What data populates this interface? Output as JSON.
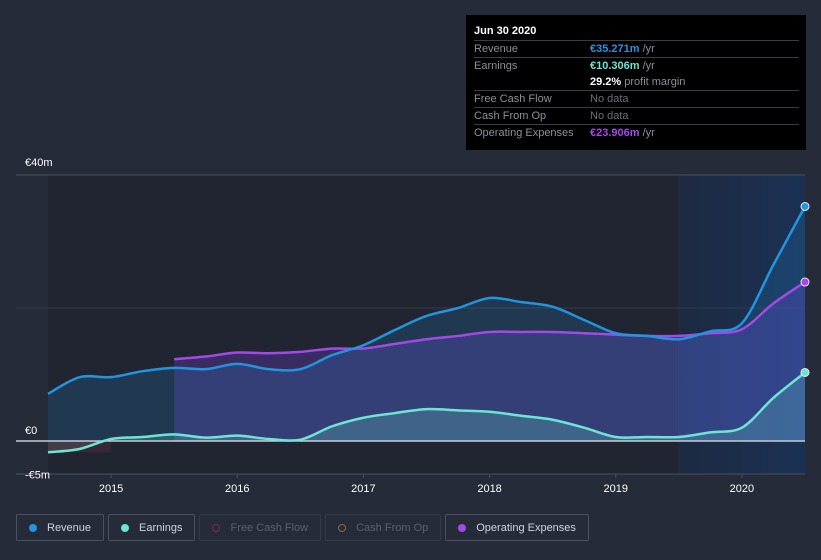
{
  "tooltip": {
    "date": "Jun 30 2020",
    "rows": [
      {
        "label": "Revenue",
        "value": "€35.271m",
        "unit": " /yr",
        "color": "#2394df"
      },
      {
        "label": "Earnings",
        "value": "€10.306m",
        "unit": " /yr",
        "color": "#6ce5d3"
      },
      {
        "label": "",
        "value": "29.2%",
        "unit": " profit margin",
        "color": "#ffffff"
      },
      {
        "label": "Free Cash Flow",
        "value": "No data",
        "unit": "",
        "color": "#6b707a"
      },
      {
        "label": "Cash From Op",
        "value": "No data",
        "unit": "",
        "color": "#6b707a"
      },
      {
        "label": "Operating Expenses",
        "value": "€23.906m",
        "unit": " /yr",
        "color": "#a349e8"
      }
    ]
  },
  "legend": [
    {
      "label": "Revenue",
      "color": "#2394df",
      "active": true
    },
    {
      "label": "Earnings",
      "color": "#6ce5d3",
      "active": true
    },
    {
      "label": "Free Cash Flow",
      "color": "#7a2f4f",
      "active": false
    },
    {
      "label": "Cash From Op",
      "color": "#8a6a3a",
      "active": false
    },
    {
      "label": "Operating Expenses",
      "color": "#a349e8",
      "active": true
    }
  ],
  "chart_data": {
    "type": "area",
    "title": "",
    "xlabel": "",
    "ylabel": "",
    "ylim": [
      -5,
      40
    ],
    "xlim": [
      2014.5,
      2020.5
    ],
    "y_tick_labels": [
      {
        "value": 40,
        "label": "€40m"
      },
      {
        "value": 0,
        "label": "€0"
      },
      {
        "value": -5,
        "label": "-€5m"
      }
    ],
    "x_tick_labels": [
      2015,
      2016,
      2017,
      2018,
      2019,
      2020
    ],
    "highlight_from": 2019.5,
    "grid": true,
    "legend_position": "bottom-left",
    "series": [
      {
        "name": "Revenue",
        "color": "#2394df",
        "x": [
          2014.5,
          2014.75,
          2015,
          2015.25,
          2015.5,
          2015.75,
          2016,
          2016.25,
          2016.5,
          2016.75,
          2017,
          2017.25,
          2017.5,
          2017.75,
          2018,
          2018.25,
          2018.5,
          2018.75,
          2019,
          2019.25,
          2019.5,
          2019.75,
          2020,
          2020.25,
          2020.5
        ],
        "values": [
          7.1,
          9.6,
          9.6,
          10.5,
          11.0,
          10.8,
          11.6,
          10.8,
          10.8,
          12.9,
          14.4,
          16.7,
          18.8,
          20.0,
          21.5,
          20.9,
          20.2,
          18.2,
          16.2,
          15.8,
          15.3,
          16.5,
          17.7,
          26.5,
          35.271
        ]
      },
      {
        "name": "Earnings",
        "color": "#6ce5d3",
        "x": [
          2014.5,
          2014.75,
          2015,
          2015.25,
          2015.5,
          2015.75,
          2016,
          2016.25,
          2016.5,
          2016.75,
          2017,
          2017.25,
          2017.5,
          2017.75,
          2018,
          2018.25,
          2018.5,
          2018.75,
          2019,
          2019.25,
          2019.5,
          2019.75,
          2020,
          2020.25,
          2020.5
        ],
        "values": [
          -1.7,
          -1.2,
          0.3,
          0.6,
          1.0,
          0.5,
          0.8,
          0.3,
          0.2,
          2.2,
          3.5,
          4.2,
          4.8,
          4.6,
          4.4,
          3.8,
          3.2,
          2.0,
          0.6,
          0.6,
          0.6,
          1.3,
          2.0,
          6.5,
          10.306
        ]
      },
      {
        "name": "Operating Expenses",
        "color": "#a349e8",
        "x": [
          2015.5,
          2015.75,
          2016,
          2016.25,
          2016.5,
          2016.75,
          2017,
          2017.25,
          2017.5,
          2017.75,
          2018,
          2018.25,
          2018.5,
          2018.75,
          2019,
          2019.25,
          2019.5,
          2019.75,
          2020,
          2020.25,
          2020.5
        ],
        "values": [
          12.3,
          12.7,
          13.3,
          13.2,
          13.4,
          13.9,
          13.9,
          14.6,
          15.3,
          15.8,
          16.4,
          16.4,
          16.4,
          16.2,
          16.0,
          15.8,
          15.8,
          16.2,
          16.8,
          20.7,
          23.906
        ]
      }
    ]
  }
}
